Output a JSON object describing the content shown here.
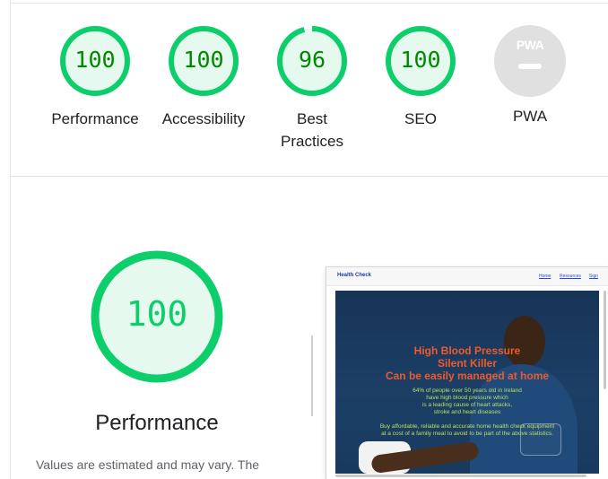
{
  "categories": [
    {
      "score": "100",
      "label": "Performance",
      "value": 100
    },
    {
      "score": "100",
      "label": "Accessibility",
      "value": 100
    },
    {
      "score": "96",
      "label": "Best Practices",
      "value": 96
    },
    {
      "score": "100",
      "label": "SEO",
      "value": 100
    }
  ],
  "pwa": {
    "badge_text": "PWA",
    "label": "PWA"
  },
  "performance": {
    "score": "100",
    "value": 100,
    "title": "Performance",
    "description": "Values are estimated and may vary. The"
  },
  "screenshot": {
    "brand": "Health Check",
    "nav_links": [
      "Home",
      "Resources",
      "Sign"
    ],
    "headline_1": "High Blood Pressure",
    "headline_2": "Silent Killer",
    "headline_3": "Can be easily managed at home",
    "body_1": "64% of people over 50 years old in Ireland",
    "body_2": "have high blood pressure which",
    "body_3": "is a leading cause of heart attacks,",
    "body_4": "stroke and heart diseases",
    "body_5": "Buy affordable, reliable and accurate home health check equipment",
    "body_6": "at a cost of a family meal to avoid to be part of the above statistics."
  },
  "colors": {
    "pass_green": "#0cce6b",
    "pass_fill": "#e6f9ef",
    "pass_text": "#008800",
    "pwa_gray": "#e0e0e0"
  },
  "icons": {
    "pwa_badge": "pwa-icon"
  }
}
